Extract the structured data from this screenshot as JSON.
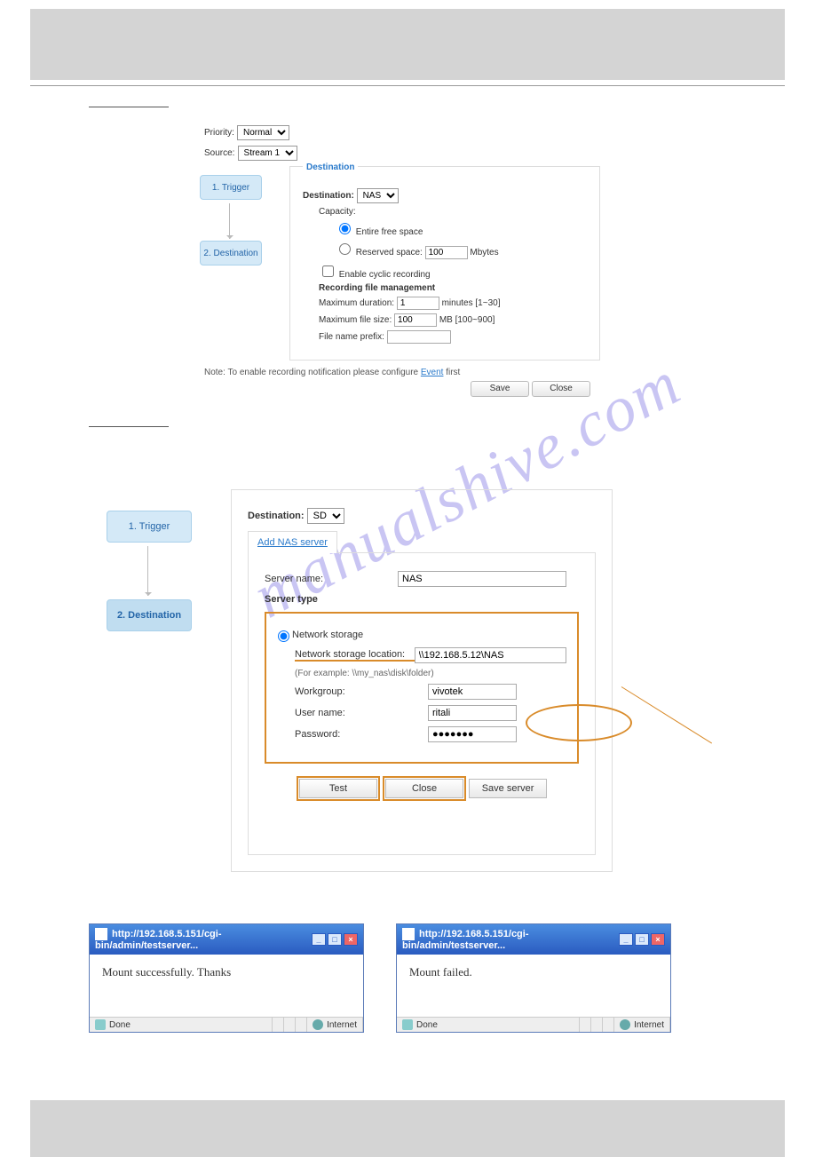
{
  "section1": {
    "priority_label": "Priority:",
    "priority_value": "Normal",
    "source_label": "Source:",
    "source_value": "Stream 1",
    "steps": {
      "s1": "1. Trigger",
      "s2": "2. Destination"
    },
    "panel": {
      "title": "Destination",
      "dest_label": "Destination:",
      "dest_value": "NAS",
      "capacity_label": "Capacity:",
      "opt_entire": "Entire free space",
      "opt_reserved": "Reserved space:",
      "reserved_value": "100",
      "reserved_unit": "Mbytes",
      "cyclic": "Enable cyclic recording",
      "rec_mgmt": "Recording file management",
      "max_dur_label": "Maximum duration:",
      "max_dur_value": "1",
      "max_dur_unit": "minutes [1~30]",
      "max_size_label": "Maximum file size:",
      "max_size_value": "100",
      "max_size_unit": "MB [100~900]",
      "prefix_label": "File name prefix:",
      "prefix_value": ""
    },
    "note_prefix": "Note: To enable recording notification please configure ",
    "note_link": "Event",
    "note_suffix": " first",
    "save": "Save",
    "close": "Close"
  },
  "section2": {
    "steps": {
      "s1": "1. Trigger",
      "s2": "2. Destination"
    },
    "dest_label": "Destination:",
    "dest_value": "SD",
    "tab": "Add NAS server",
    "server_name_label": "Server name:",
    "server_name_value": "NAS",
    "server_type_label": "Server type",
    "net_storage": "Network storage",
    "loc_label": "Network storage location:",
    "loc_value": "\\\\192.168.5.12\\NAS",
    "example": "(For example: \\\\my_nas\\disk\\folder)",
    "workgroup_label": "Workgroup:",
    "workgroup_value": "vivotek",
    "user_label": "User name:",
    "user_value": "ritali",
    "pass_label": "Password:",
    "pass_value": "●●●●●●●",
    "btn_test": "Test",
    "btn_close": "Close",
    "btn_save": "Save server"
  },
  "popups": {
    "title": "http://192.168.5.151/cgi-bin/admin/testserver...",
    "msg_ok": "Mount successfully. Thanks",
    "msg_fail": "Mount failed.",
    "done": "Done",
    "internet": "Internet"
  },
  "watermark": "manualshive.com"
}
